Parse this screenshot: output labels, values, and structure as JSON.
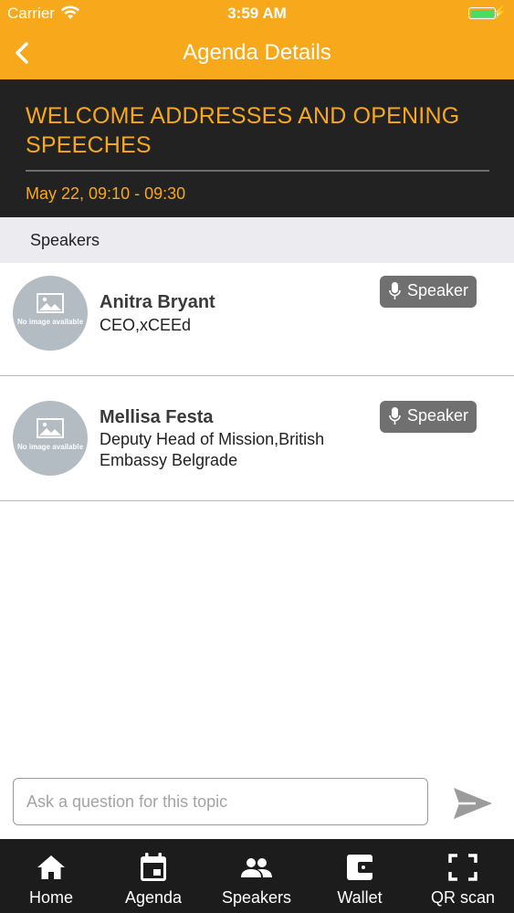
{
  "status_bar": {
    "carrier": "Carrier",
    "time": "3:59 AM",
    "battery_color": "#4cd964"
  },
  "nav": {
    "title": "Agenda Details",
    "back_icon": "chevron-left-icon"
  },
  "agenda": {
    "title": "WELCOME ADDRESSES AND OPENING SPEECHES",
    "time": "May 22, 09:10 - 09:30"
  },
  "section": {
    "title": "Speakers"
  },
  "speakers": [
    {
      "name": "Anitra Bryant",
      "role": "CEO,xCEEd",
      "badge": "Speaker",
      "avatar_text": "No image available"
    },
    {
      "name": "Mellisa Festa",
      "role": "Deputy Head of Mission,British Embassy Belgrade",
      "badge": "Speaker",
      "avatar_text": "No image available"
    }
  ],
  "question": {
    "placeholder": "Ask a question for this topic",
    "value": ""
  },
  "tabs": [
    {
      "label": "Home",
      "icon": "home-icon"
    },
    {
      "label": "Agenda",
      "icon": "calendar-icon"
    },
    {
      "label": "Speakers",
      "icon": "people-icon"
    },
    {
      "label": "Wallet",
      "icon": "wallet-icon"
    },
    {
      "label": "QR scan",
      "icon": "qr-scan-icon"
    }
  ],
  "colors": {
    "accent": "#f7a81b",
    "header_bg": "#222222",
    "tabbar_bg": "#1c1c1c",
    "badge_bg": "#707070"
  }
}
